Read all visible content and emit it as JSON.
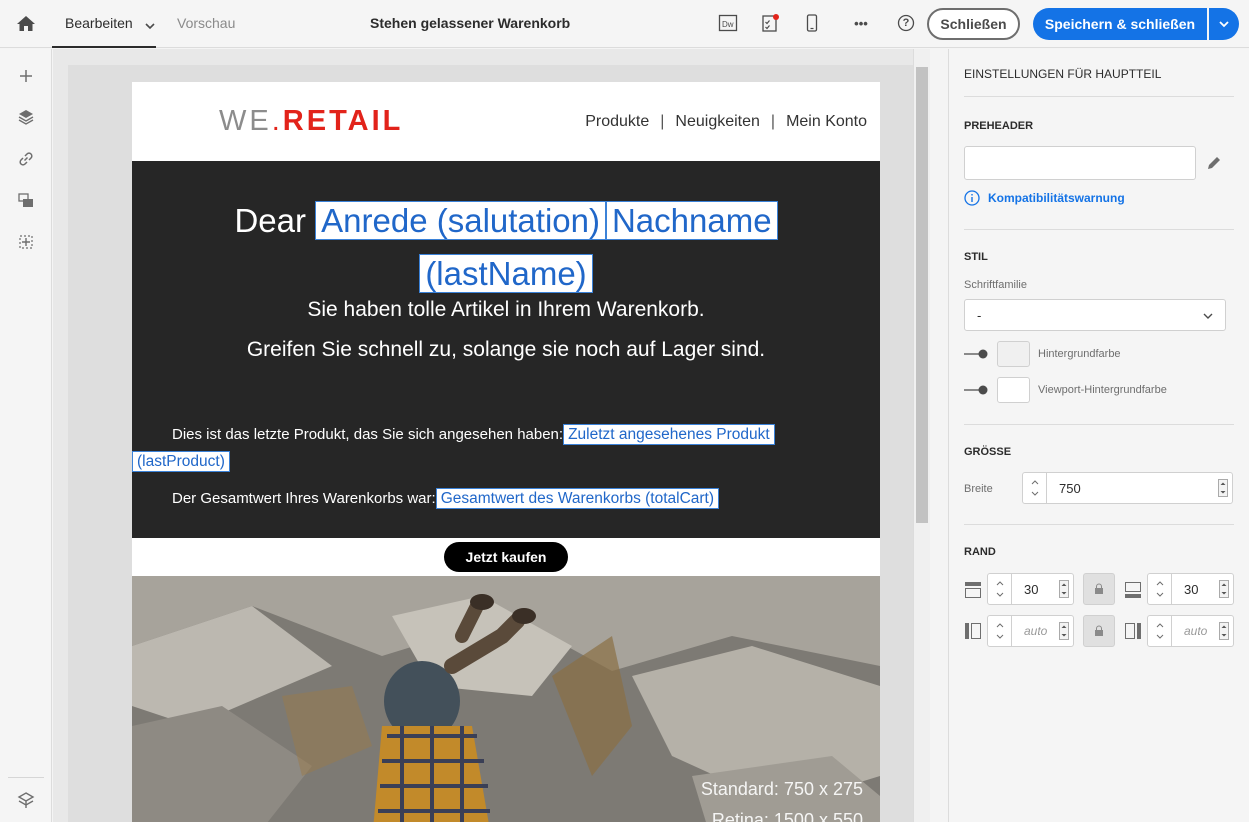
{
  "topbar": {
    "tab_edit": "Bearbeiten",
    "tab_preview": "Vorschau",
    "title": "Stehen gelassener Warenkorb",
    "close_label": "Schließen",
    "save_label": "Speichern & schließen",
    "help": "?",
    "more": "•••",
    "dw_label": "Dw"
  },
  "email": {
    "logo_we": "WE",
    "logo_dot": ".",
    "logo_retail": "RETAIL",
    "nav": [
      "Produkte",
      "|",
      "Neuigkeiten",
      "|",
      "Mein Konto"
    ],
    "greet_prefix": "Dear",
    "tag_salutation": "Anrede (salutation)",
    "tag_lastname_a": "Nachname",
    "tag_lastname_b": "(lastName)",
    "line1": "Sie haben tolle Artikel in Ihrem Warenkorb.",
    "line2": "Greifen Sie schnell zu, solange sie noch auf Lager sind.",
    "p1_text": "Dies ist das letzte Produkt, das Sie sich angesehen haben:",
    "tag_last_product_a": "Zuletzt angesehenes Produkt",
    "tag_last_product_b": "(lastProduct)",
    "p2_text": "Der Gesamtwert Ihres Warenkorbs war:",
    "tag_total_cart": "Gesamtwert des Warenkorbs (totalCart)",
    "cta": "Jetzt kaufen",
    "img_dim_standard": "Standard: 750 x 275",
    "img_dim_retina": "Retina: 1500 x 550"
  },
  "panel": {
    "title": "EINSTELLUNGEN FÜR HAUPTTEIL",
    "preheader_heading": "PREHEADER",
    "preheader_value": "",
    "compat_warning": "Kompatibilitätswarnung",
    "style_heading": "STIL",
    "font_family_label": "Schriftfamilie",
    "font_family_value": "-",
    "bg_color_label": "Hintergrundfarbe",
    "viewport_bg_label": "Viewport-Hintergrundfarbe",
    "size_heading": "GRÖSSE",
    "width_label": "Breite",
    "width_value": "750",
    "margin_heading": "RAND",
    "margin_top": "30",
    "margin_bottom": "30",
    "margin_left": "auto",
    "margin_right": "auto"
  },
  "colors": {
    "accent": "#1473e6",
    "brand_red": "#e2231a",
    "email_dark_bg": "#262626"
  }
}
